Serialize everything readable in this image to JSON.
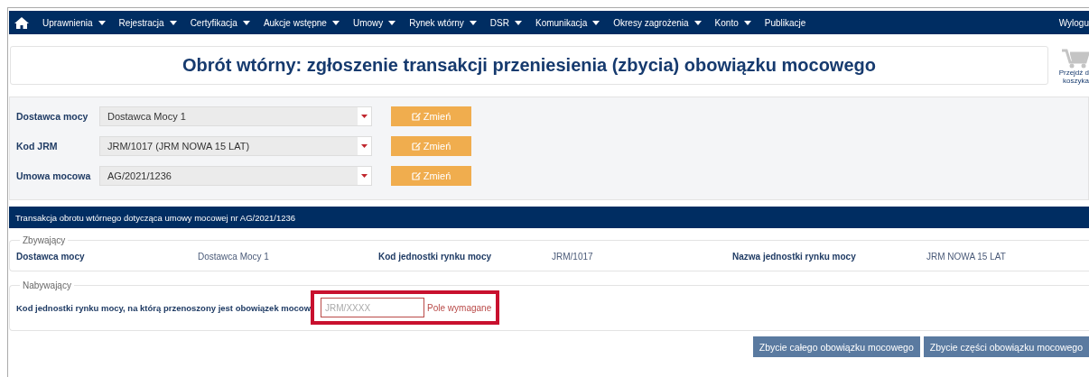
{
  "nav": {
    "items": [
      {
        "label": "Uprawnienia",
        "dropdown": true
      },
      {
        "label": "Rejestracja",
        "dropdown": true
      },
      {
        "label": "Certyfikacja",
        "dropdown": true
      },
      {
        "label": "Aukcje wstępne",
        "dropdown": true
      },
      {
        "label": "Umowy",
        "dropdown": true
      },
      {
        "label": "Rynek wtórny",
        "dropdown": true
      },
      {
        "label": "DSR",
        "dropdown": true
      },
      {
        "label": "Komunikacja",
        "dropdown": true
      },
      {
        "label": "Okresy zagrożenia",
        "dropdown": true
      },
      {
        "label": "Konto",
        "dropdown": true
      },
      {
        "label": "Publikacje",
        "dropdown": false
      }
    ],
    "logout": "Wylogu"
  },
  "title": "Obrót wtórny: zgłoszenie transakcji przeniesienia (zbycia) obowiązku mocowego",
  "cart": {
    "lines": [
      "Przejdź d",
      "koszyka"
    ]
  },
  "form": {
    "rows": [
      {
        "label": "Dostawca mocy",
        "value": "Dostawca Mocy 1",
        "button": "Zmień"
      },
      {
        "label": "Kod JRM",
        "value": "JRM/1017 (JRM NOWA 15 LAT)",
        "button": "Zmień"
      },
      {
        "label": "Umowa mocowa",
        "value": "AG/2021/1236",
        "button": "Zmień"
      }
    ]
  },
  "section_title": "Transakcja obrotu wtórnego dotycząca umowy mocowej nr AG/2021/1236",
  "seller": {
    "legend": "Zbywający",
    "fields": [
      {
        "label": "Dostawca mocy",
        "value": "Dostawca Mocy 1"
      },
      {
        "label": "Kod jednostki rynku mocy",
        "value": "JRM/1017"
      },
      {
        "label": "Nazwa jednostki rynku mocy",
        "value": "JRM NOWA 15 LAT"
      }
    ]
  },
  "buyer": {
    "legend": "Nabywający",
    "label": "Kod jednostki rynku mocy, na którą przenoszony jest obowiązek mocow",
    "input": {
      "placeholder": "JRM/XXXX",
      "error": "Pole wymagane",
      "highlighted": true
    }
  },
  "actions": [
    "Zbycie całego obowiązku mocowego",
    "Zbycie części obowiązku mocowego"
  ]
}
